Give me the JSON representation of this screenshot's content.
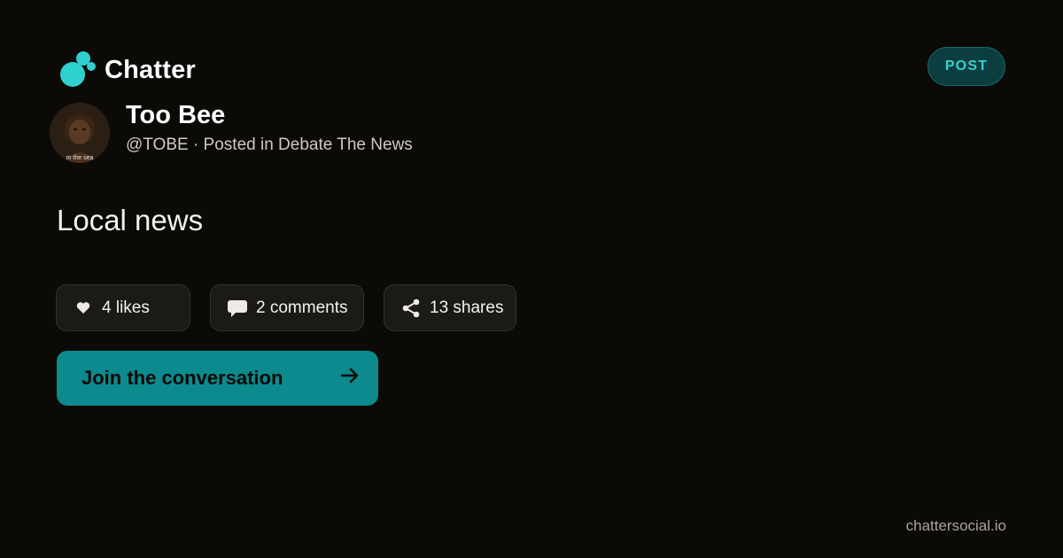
{
  "brand": {
    "name": "Chatter",
    "accent": "#2fd1d0"
  },
  "badge": {
    "label": "POST"
  },
  "author": {
    "name": "Too Bee",
    "meta": "@TOBE · Posted in Debate The News",
    "avatar_caption": "m the sea"
  },
  "post": {
    "text": "Local news"
  },
  "stats": {
    "likes": {
      "label": "4 likes",
      "icon": "heart-icon"
    },
    "comments": {
      "label": "2 comments",
      "icon": "comment-bubble-icon"
    },
    "shares": {
      "label": "13 shares",
      "icon": "share-icon"
    }
  },
  "cta": {
    "label": "Join the conversation",
    "icon": "arrow-right-icon",
    "color": "#0c8a8d"
  },
  "footer": {
    "domain": "chattersocial.io"
  }
}
